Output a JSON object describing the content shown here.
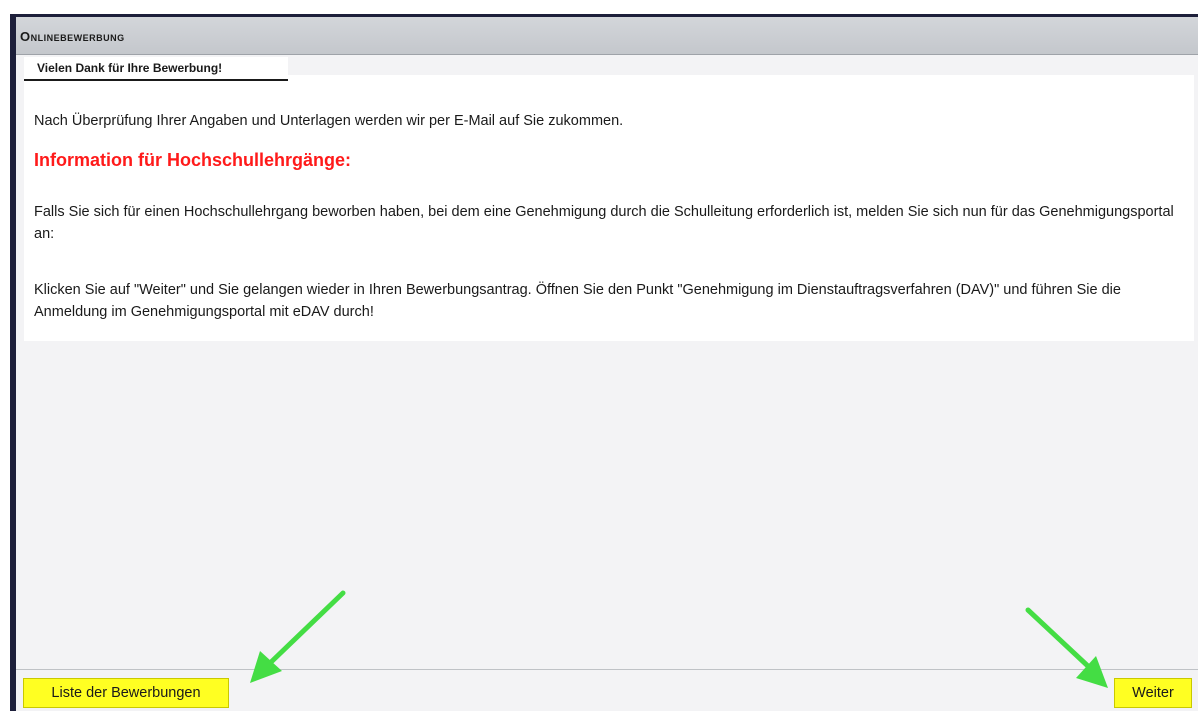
{
  "window": {
    "title": "Onlinebewerbung"
  },
  "main": {
    "section_title": "Vielen Dank für Ihre Bewerbung!",
    "intro": "Nach Überprüfung Ihrer Angaben und Unterlagen werden wir per E-Mail auf Sie zukommen.",
    "info_heading": "Information für Hochschullehrgänge:",
    "info_paragraph_1": "Falls Sie sich für einen Hochschullehrgang beworben haben, bei dem eine Genehmigung durch die Schulleitung erforderlich ist, melden Sie sich nun für das Genehmigungsportal an:",
    "info_paragraph_2": "Klicken Sie auf \"Weiter\" und Sie gelangen wieder in Ihren Bewerbungsantrag. Öffnen Sie den Punkt \"Genehmigung im Dienstauftragsverfahren (DAV)\" und führen Sie die Anmeldung im Genehmigungsportal mit eDAV durch!"
  },
  "footer": {
    "list_button": "Liste der Bewerbungen",
    "next_button": "Weiter"
  },
  "colors": {
    "heading_red": "#ff1a1a",
    "highlight_yellow": "#ffff22",
    "annotation_arrow": "#44dd44",
    "frame_border": "#1d1f3a"
  },
  "icons": {
    "annotation_left": "arrow-down-left-icon",
    "annotation_right": "arrow-down-right-icon"
  }
}
